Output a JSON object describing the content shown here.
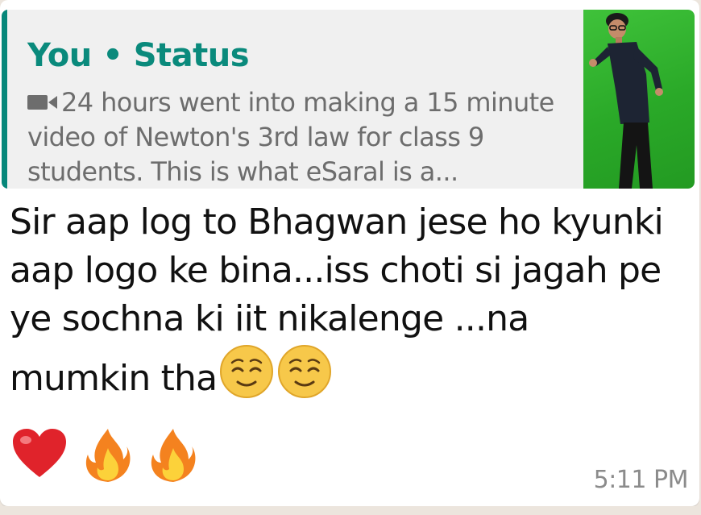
{
  "quoted_status": {
    "author": "You",
    "separator": "•",
    "label": "Status",
    "media_icon": "video-camera-icon",
    "text": "24 hours went into making a 15 minute video of Newton's 3rd law for class 9 students. This is what eSaral is a..."
  },
  "message": {
    "text": "Sir aap log to Bhagwan jese ho kyunki aap logo ke bina...iss choti si jagah pe ye sochna ki iit nikalenge ...na mumkin tha",
    "inline_emojis": [
      "relieved-face",
      "relieved-face"
    ],
    "reaction_emojis": [
      "red-heart",
      "fire",
      "fire"
    ],
    "time": "5:11 PM"
  },
  "colors": {
    "accent": "#06877a",
    "author": "#0a8a7c",
    "quote_bg": "#f0f0f0",
    "bubble_bg": "#ffffff",
    "chat_bg": "#ece5dd",
    "thumbnail_green": "#2aa928"
  }
}
